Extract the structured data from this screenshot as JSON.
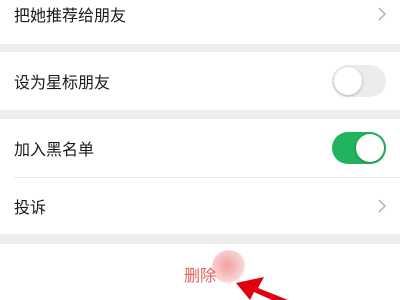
{
  "rows": {
    "recommend": {
      "label": "把她推荐给朋友"
    },
    "star_friend": {
      "label": "设为星标朋友",
      "enabled": false
    },
    "blacklist": {
      "label": "加入黑名单",
      "enabled": true
    },
    "complain": {
      "label": "投诉"
    }
  },
  "delete": {
    "label": "删除"
  },
  "icons": {
    "chevron": "chevron-right-icon"
  },
  "colors": {
    "toggle_on": "#22b35e",
    "delete_text": "#e06060",
    "background": "#ededed"
  }
}
